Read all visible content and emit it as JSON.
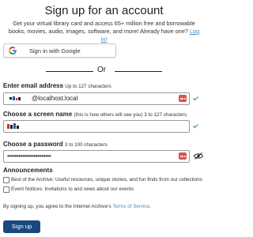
{
  "header": {
    "title": "Sign up for an account"
  },
  "intro": {
    "text": "Get your virtual library card and access 65+ million free and borrowable books, movies, audio, images, software, and more! Already have one?",
    "login_link": "Log in!"
  },
  "google": {
    "label": "Sign in with Google",
    "icon": "google-g-icon"
  },
  "divider": {
    "text": "Or"
  },
  "email": {
    "label": "Enter email address",
    "hint": "Up to 127 characters",
    "value": "@localhost.local"
  },
  "screen_name": {
    "label": "Choose a screen name",
    "hint": "(this is how others will see you) 3 to 127 characters"
  },
  "password": {
    "label": "Choose a password",
    "hint": "3 to 100 characters",
    "value": "•••••••••••••••••••••••"
  },
  "announcements": {
    "heading": "Announcements",
    "items": [
      {
        "label": "Best of the Archive: Useful resources, unique stories, and fun finds from our collections",
        "checked": false
      },
      {
        "label": "Event Notices: Invitations to and news about our events",
        "checked": false
      }
    ]
  },
  "terms": {
    "prefix": "By signing up, you agree to the Internet Archive's",
    "link": "Terms of Service",
    "suffix": "."
  },
  "submit": {
    "label": "Sign up"
  },
  "colors": {
    "link": "#428bca",
    "button": "#194880",
    "valid_check": "#3a9a4a",
    "keypass": "#d9534f"
  }
}
